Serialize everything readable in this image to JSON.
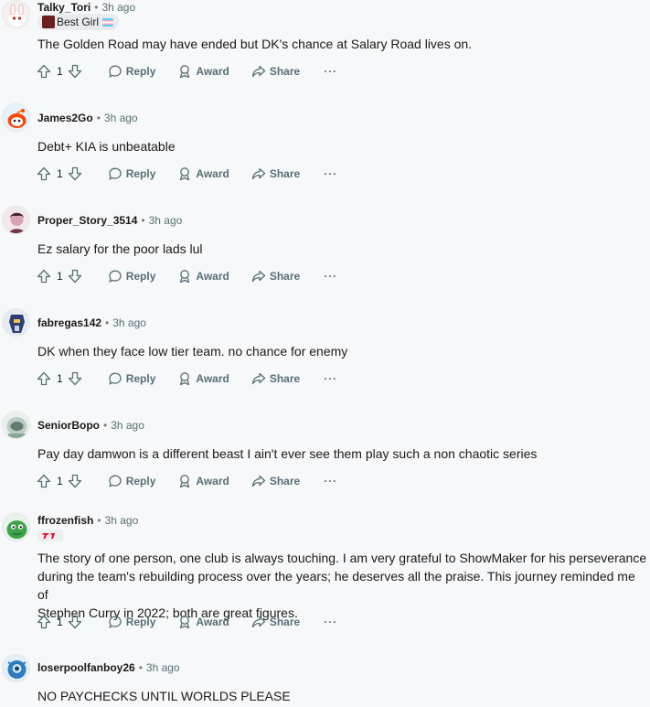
{
  "actions": {
    "reply_label": "Reply",
    "award_label": "Award",
    "share_label": "Share",
    "more_label": "···"
  },
  "comments": [
    {
      "username": "Talky_Tori",
      "separator": "•",
      "time": "3h ago",
      "flair_text": "Best Girl",
      "body": "The Golden Road may have ended but DK's chance at Salary Road lives on.",
      "score": "1",
      "avatar_icon": "bunny-avatar-icon"
    },
    {
      "username": "James2Go",
      "separator": "•",
      "time": "3h ago",
      "body": "Debt+ KIA is unbeatable",
      "score": "1",
      "avatar_icon": "snoo-avatar-icon"
    },
    {
      "username": "Proper_Story_3514",
      "separator": "•",
      "time": "3h ago",
      "body": "Ez salary for the poor lads lul",
      "score": "1",
      "avatar_icon": "character-avatar-icon"
    },
    {
      "username": "fabregas142",
      "separator": "•",
      "time": "3h ago",
      "body": "DK when they face low tier team. no chance for enemy",
      "score": "1",
      "avatar_icon": "robot-avatar-icon"
    },
    {
      "username": "SeniorBopo",
      "separator": "•",
      "time": "3h ago",
      "body": "Pay day damwon is a different beast I ain't ever see them play such a non chaotic series",
      "score": "1",
      "avatar_icon": "helmet-avatar-icon"
    },
    {
      "username": "ffrozenfish",
      "separator": "•",
      "time": "3h ago",
      "team_flair_icon": "t1-logo-icon",
      "body_lines": [
        "The story of one person, one club is always touching. I am very grateful to ShowMaker for his perseverance",
        "during the team's rebuilding process over the years; he deserves all the praise. This journey reminded me of",
        "Stephen Curry in 2022; both are great figures."
      ],
      "score": "1",
      "avatar_icon": "green-creature-avatar-icon"
    },
    {
      "username": "loserpoolfanboy26",
      "separator": "•",
      "time": "3h ago",
      "body": "NO PAYCHECKS UNTIL WORLDS PLEASE",
      "avatar_icon": "blue-mascot-avatar-icon"
    }
  ],
  "colors": {
    "background": "#f7f8f9",
    "meta_text": "#576f76",
    "primary_text": "#1a1a1b",
    "t1_red": "#e2012d"
  }
}
